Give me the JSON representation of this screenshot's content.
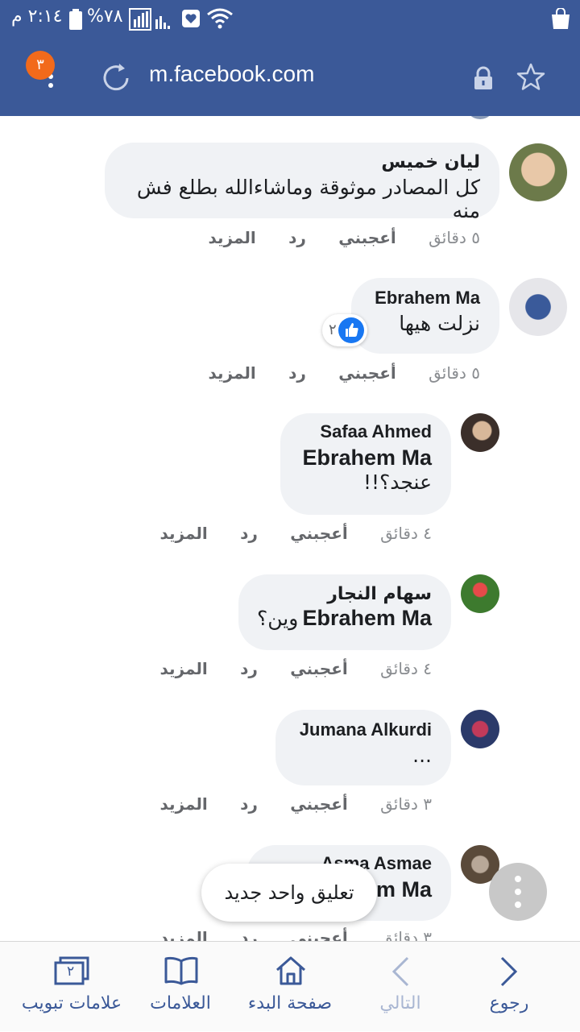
{
  "status_bar": {
    "time": "٢:١٤ م",
    "battery": "%٧٨"
  },
  "browser": {
    "url": "m.facebook.com",
    "tab_badge_count": "٣"
  },
  "comments": [
    {
      "author": "ليان خميس",
      "text": "كل المصادر موثوقة وماشاءالله بطلع فش منه",
      "time": "٥ دقائق",
      "like": "أعجبني",
      "reply": "رد",
      "more": "المزيد"
    },
    {
      "author": "Ebrahem Ma",
      "text": "نزلت هيها",
      "reaction_count": "٢",
      "time": "٥ دقائق",
      "like": "أعجبني",
      "reply": "رد",
      "more": "المزيد"
    },
    {
      "author": "Safaa Ahmed",
      "mention": "Ebrahem Ma",
      "text": "عنجد؟!!",
      "time": "٤ دقائق",
      "like": "أعجبني",
      "reply": "رد",
      "more": "المزيد"
    },
    {
      "author": "سهام النجار",
      "mention": "Ebrahem Ma",
      "text": "وين؟",
      "time": "٤ دقائق",
      "like": "أعجبني",
      "reply": "رد",
      "more": "المزيد"
    },
    {
      "author": "Jumana Alkurdi",
      "text": "...",
      "time": "٣ دقائق",
      "like": "أعجبني",
      "reply": "رد",
      "more": "المزيد"
    },
    {
      "author": "Asma Asmae",
      "mention": "Ebrahem Ma",
      "time": "٣ دقائق",
      "like": "أعجبني",
      "reply": "رد",
      "more": "المزيد"
    }
  ],
  "toast": {
    "label": "تعليق واحد جديد"
  },
  "bottom_nav": {
    "back": "رجوع",
    "forward": "التالي",
    "home": "صفحة البدء",
    "bookmarks": "العلامات",
    "tabs": "علامات تبويب",
    "tabs_count": "٢"
  },
  "colors": {
    "brand": "#3b5998",
    "bubble": "#f0f2f5",
    "badge": "#f26a1b",
    "like_blue": "#1877f2"
  }
}
